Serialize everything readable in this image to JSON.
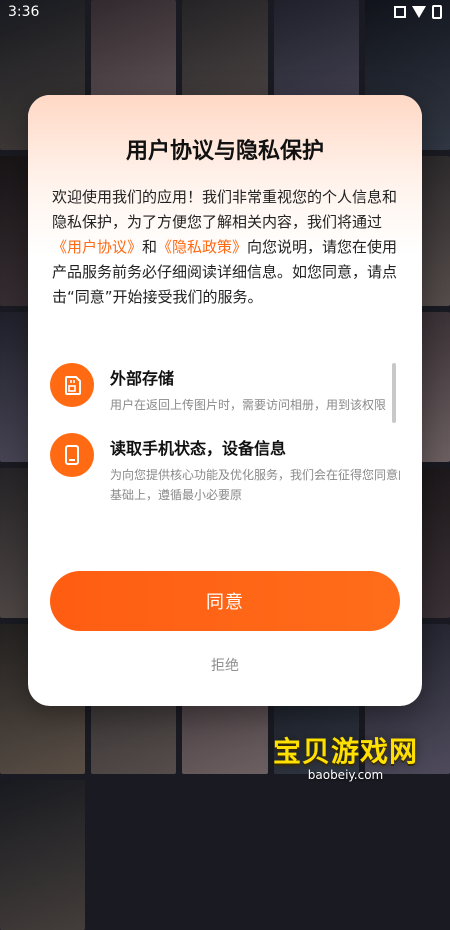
{
  "statusbar": {
    "time": "3:36"
  },
  "dialog": {
    "title": "用户协议与隐私保护",
    "body_part1": "欢迎使用我们的应用！我们非常重视您的个人信息和隐私保护，为了方便您了解相关内容，我们将通过",
    "link_user_agreement": "《用户协议》",
    "body_and": "和",
    "link_privacy": "《隐私政策》",
    "body_part2": "向您说明，请您在使用产品服务前务必仔细阅读详细信息。如您同意，请点击“同意”开始接受我们的服务。",
    "permissions": [
      {
        "title": "外部存储",
        "desc": "用户在返回上传图片时，需要访问相册，用到该权限",
        "icon": "sd-card-icon"
      },
      {
        "title": "读取手机状态，设备信息",
        "desc": "为向您提供核心功能及优化服务，我们会在征得您同意的基础上，遵循最小必要原",
        "icon": "phone-icon"
      }
    ],
    "agree_label": "同意",
    "reject_label": "拒绝"
  },
  "watermark": {
    "text": "宝贝游戏网",
    "url": "baobeiy.com"
  },
  "colors": {
    "accent": "#ff6a13"
  }
}
